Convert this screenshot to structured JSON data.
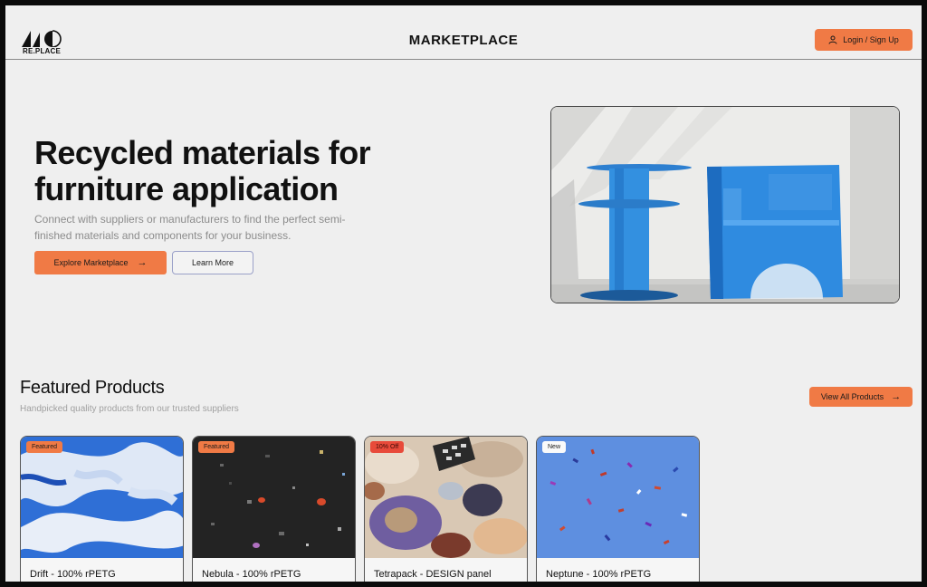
{
  "header": {
    "logo_text": "RE.PLACE",
    "title": "MARKETPLACE",
    "login_label": "Login / Sign Up"
  },
  "hero": {
    "title": "Recycled materials for furniture application",
    "subtitle": "Connect with suppliers or manufacturers to find the perfect semi-finished materials and components for your business.",
    "primary_button": "Explore Marketplace",
    "secondary_button": "Learn More"
  },
  "featured": {
    "title": "Featured Products",
    "subtitle": "Handpicked quality products from our trusted suppliers",
    "view_all_label": "View All Products",
    "products": [
      {
        "name": "Drift - 100% rPETG",
        "badge": "Featured",
        "badge_color": "#f07a45"
      },
      {
        "name": "Nebula - 100% rPETG",
        "badge": "Featured",
        "badge_color": "#f07a45"
      },
      {
        "name": "Tetrapack - DESIGN panel",
        "badge": "10% Off",
        "badge_color": "#e84a3a"
      },
      {
        "name": "Neptune - 100% rPETG",
        "badge": "New",
        "badge_color": "#fafafa"
      }
    ]
  },
  "colors": {
    "accent": "#f07a45",
    "background": "#efefef",
    "text": "#111111"
  }
}
